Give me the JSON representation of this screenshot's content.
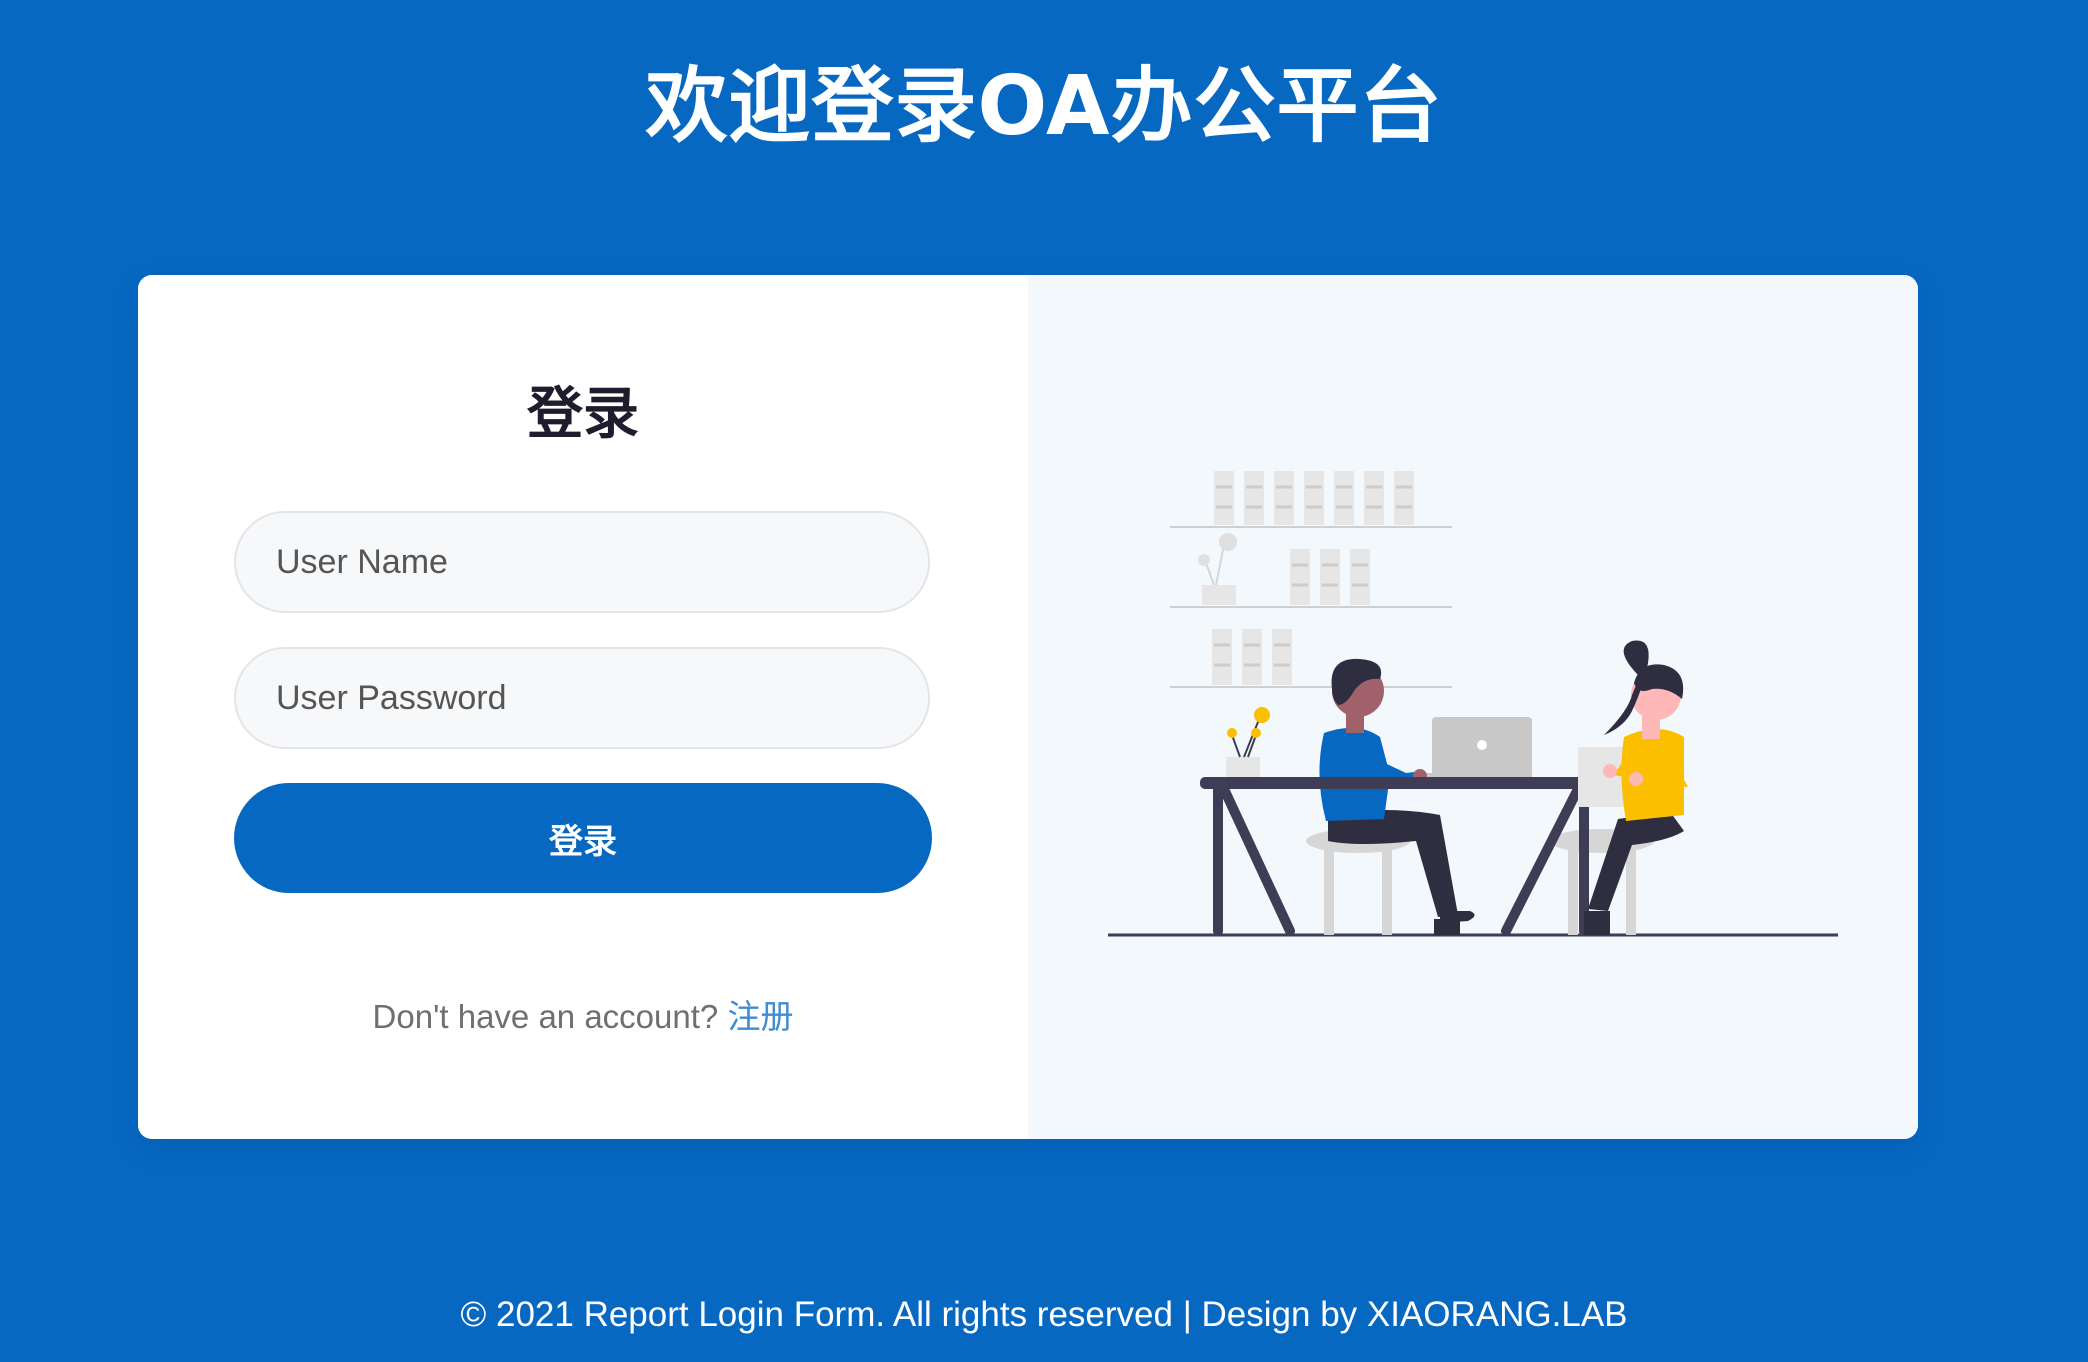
{
  "header": {
    "title": "欢迎登录OA办公平台"
  },
  "login_form": {
    "title": "登录",
    "username_placeholder": "User Name",
    "password_placeholder": "User Password",
    "submit_label": "登录",
    "signup_prompt": "Don't have an account?",
    "signup_link_label": "注册"
  },
  "illustration": {
    "icon": "office-teamwork-illustration",
    "colors": {
      "person_left_shirt": "#0768c2",
      "person_right_shirt": "#fbbf00",
      "desk": "#3f3d56",
      "laptop": "#c8c8c8"
    }
  },
  "footer": {
    "copyright": "© 2021 Report Login Form. All rights reserved | Design by XIAORANG.LAB"
  },
  "colors": {
    "background": "#0768c2",
    "card": "#ffffff",
    "illustration_panel": "#f3f8fc",
    "link": "#3f8bd4"
  }
}
